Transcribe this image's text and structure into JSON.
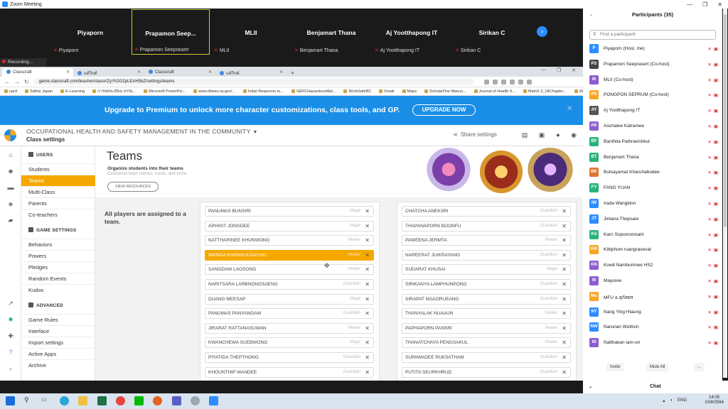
{
  "zoom": {
    "title": "Zoom Meeting",
    "recording": "Recording..."
  },
  "gallery": [
    {
      "name": "Piyaporn",
      "label": "Piyaporn"
    },
    {
      "name": "Prapamon  Seep...",
      "label": "Prapamon Seeprasert",
      "active": true
    },
    {
      "name": "MLII",
      "label": "MLII"
    },
    {
      "name": "Benjamart Thana",
      "label": "Benjamart Thana"
    },
    {
      "name": "Aj Yootthapong IT",
      "label": "Aj Yootthapong IT"
    },
    {
      "name": "Sirikan C",
      "label": "Sirikan C"
    }
  ],
  "browser": {
    "tabs": [
      "Classcraft",
      "แค้วิกด์",
      "Classcraft",
      "แค้วิกด์"
    ],
    "url": "game.classcraft.com/teacher/class/rZyYh2G2pLEAH5bZ/settings/teams",
    "bookmarks": [
      "uard",
      "Safety Japan",
      "E-Learning",
      "การจดทะเบียน ธรรม...",
      "Microsoft PowerPoi...",
      "www.dliwes.ny.gov/...",
      "Initial Response to...",
      "SERCHazardousMat...",
      "WorkSafeBC",
      "Gmail",
      "Maps",
      "ScholarOne Manus...",
      "Journal of Health S...",
      "MainX-2_04Chapter...",
      "ส่งผลงาน"
    ]
  },
  "banner": {
    "text": "Upgrade to Premium to unlock more character customizations, class tools, and GP.",
    "button": "UPGRADE NOW",
    "close": "✕"
  },
  "header": {
    "course": "OCCUPATIONAL HEALTH AND SAFETY MANAGEMENT IN THE COMMUNITY",
    "subtitle": "Class settings",
    "share": "Share settings"
  },
  "sidebar": {
    "users_title": "USERS",
    "users": [
      "Students",
      "Teams",
      "Multi-Class",
      "Parents",
      "Co-teachers"
    ],
    "game_title": "GAME SETTINGS",
    "game": [
      "Behaviors",
      "Powers",
      "Pledges",
      "Random Events",
      "Kudos"
    ],
    "adv_title": "ADVANCED",
    "advanced": [
      "Game Rules",
      "Interface",
      "Import settings",
      "Active Apps",
      "Archive"
    ]
  },
  "teams": {
    "title": "Teams",
    "sub": "Organize students into their teams",
    "sub2": "Customize team names, crests, and more",
    "view": "VIEW RESOURCES",
    "all_assigned": "All players are assigned to a team."
  },
  "left_team": [
    {
      "name": "PANUMAS BUNSIRI",
      "cls": "Mage"
    },
    {
      "name": "APHISIT JONGDEE",
      "cls": "Mage"
    },
    {
      "name": "NATTHARINEE KHUNWONG",
      "cls": "Healer"
    },
    {
      "name": "WIPADA KHONKULDACHO",
      "cls": "Healer",
      "hl": true
    },
    {
      "name": "SANGDAW LAOSONG",
      "cls": "Healer"
    },
    {
      "name": "NARITSARA LARBNONGSAENG",
      "cls": "Guardian"
    },
    {
      "name": "DUANG MEESAP",
      "cls": "Mage"
    },
    {
      "name": "PANUMAS PANYANGAM",
      "cls": "Guardian"
    },
    {
      "name": "JIRARAT RATTANASUWAN",
      "cls": "Healer"
    },
    {
      "name": "KWANCHEWA SUEBWONG",
      "cls": "Mage"
    },
    {
      "name": "PIYATIDA THEPTHONG",
      "cls": "Guardian"
    },
    {
      "name": "KHOUNTHIP WANDEE",
      "cls": "Guardian"
    }
  ],
  "right_team": [
    {
      "name": "CHATCHA ANEKSRI",
      "cls": "Guardian"
    },
    {
      "name": "THAPANAPORN BOONFU",
      "cls": "Guardian"
    },
    {
      "name": "PAWEENA JERMTA",
      "cls": "Healer"
    },
    {
      "name": "NAREERAT JUIKRAYANG",
      "cls": "Guardian"
    },
    {
      "name": "SUDARAT KHUSAI",
      "cls": "Mage"
    },
    {
      "name": "SIRIKANYA LAMPHUNPONG",
      "cls": "Guardian"
    },
    {
      "name": "SIRAPAT NGAORUEANG",
      "cls": "Guardian"
    },
    {
      "name": "THANYALAK NUAAUN",
      "cls": "Healer"
    },
    {
      "name": "PAPHAPORN PANSRI",
      "cls": "Healer"
    },
    {
      "name": "THANATCHAYA PENGSAKUL",
      "cls": "Healer"
    },
    {
      "name": "SUPAWADEE RUKSATHAM",
      "cls": "Guardian"
    },
    {
      "name": "PUTITA SEURKHRUD",
      "cls": "Guardian"
    }
  ],
  "participants": {
    "title": "Participants (35)",
    "search": "Find a participant",
    "list": [
      {
        "av": "P",
        "name": "Piyaporn (Host, me)",
        "color": "#2d8cff"
      },
      {
        "av": "PS",
        "name": "Prapamon Seeprasert (Co-host)",
        "color": "#444"
      },
      {
        "av": "M",
        "name": "MLII (Co-host)",
        "color": "#8e5bd0"
      },
      {
        "av": "PS",
        "name": "PONGPON SEPRUM (Co-host)",
        "color": "#f5a623"
      },
      {
        "av": "AY",
        "name": "Aj Yootthapong IT",
        "color": "#555"
      },
      {
        "av": "AK",
        "name": "Anchalee Katramee",
        "color": "#8e5bd0"
      },
      {
        "av": "BP",
        "name": "Banthita Pathravishkul",
        "color": "#2ab27b"
      },
      {
        "av": "BT",
        "name": "Benjamart Thana",
        "color": "#2ab27b"
      },
      {
        "av": "BK",
        "name": "Butsayamat Kharuhabodee",
        "color": "#e0762b"
      },
      {
        "av": "FY",
        "name": "FANG YUAN",
        "color": "#2ab27b"
      },
      {
        "av": "IW",
        "name": "Irada Wangklon",
        "color": "#2d8cff"
      },
      {
        "av": "JT",
        "name": "Jintana Thepsaw",
        "color": "#2d8cff"
      },
      {
        "av": "KS",
        "name": "Karn Soponronnarit",
        "color": "#2ab27b"
      },
      {
        "av": "KR",
        "name": "Kittiphum ruangravevat",
        "color": "#f5a623"
      },
      {
        "av": "KN",
        "name": "Kowit Nambunmee HS2",
        "color": "#8e5bd0"
      },
      {
        "av": "M",
        "name": "Mayuree",
        "color": "#8e5bd0"
      },
      {
        "av": "Mu",
        "name": "MFU อ.สุภัสตร",
        "color": "#f5a623"
      },
      {
        "av": "NY",
        "name": "Nang Ying Htaung",
        "color": "#2d8cff"
      },
      {
        "av": "NW",
        "name": "Narunan Wuttisin",
        "color": "#2d8cff"
      },
      {
        "av": "NI",
        "name": "Natthakan iam-on",
        "color": "#8e5bd0"
      }
    ],
    "invite": "Invite",
    "muteall": "Mute All",
    "more": "...",
    "chat": "Chat"
  },
  "taskbar": {
    "time": "14:05",
    "date": "10/8/2564",
    "lang": "ENG"
  }
}
